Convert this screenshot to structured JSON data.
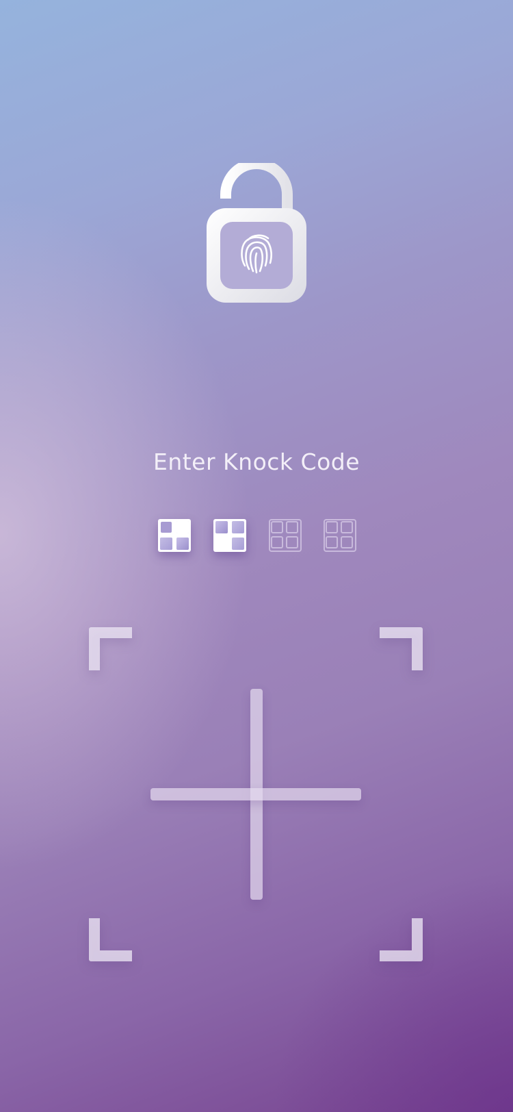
{
  "lock_screen": {
    "icon": "unlocked-padlock-fingerprint-icon",
    "title": "Enter Knock Code",
    "progress": {
      "total": 4,
      "entered": 2,
      "entries": [
        {
          "state": "filled",
          "highlighted_quadrant": "bottom-right"
        },
        {
          "state": "filled",
          "highlighted_quadrant": "top-left"
        },
        {
          "state": "empty"
        },
        {
          "state": "empty"
        }
      ]
    },
    "knock_pad": {
      "quadrants": [
        "top-left",
        "top-right",
        "bottom-left",
        "bottom-right"
      ]
    }
  },
  "colors": {
    "background_top": "#95b3dd",
    "background_bottom": "#76428f",
    "text": "#f3eff8",
    "filled_cell_highlight": "#b8afe0",
    "pad_lines": "#e4daee"
  }
}
